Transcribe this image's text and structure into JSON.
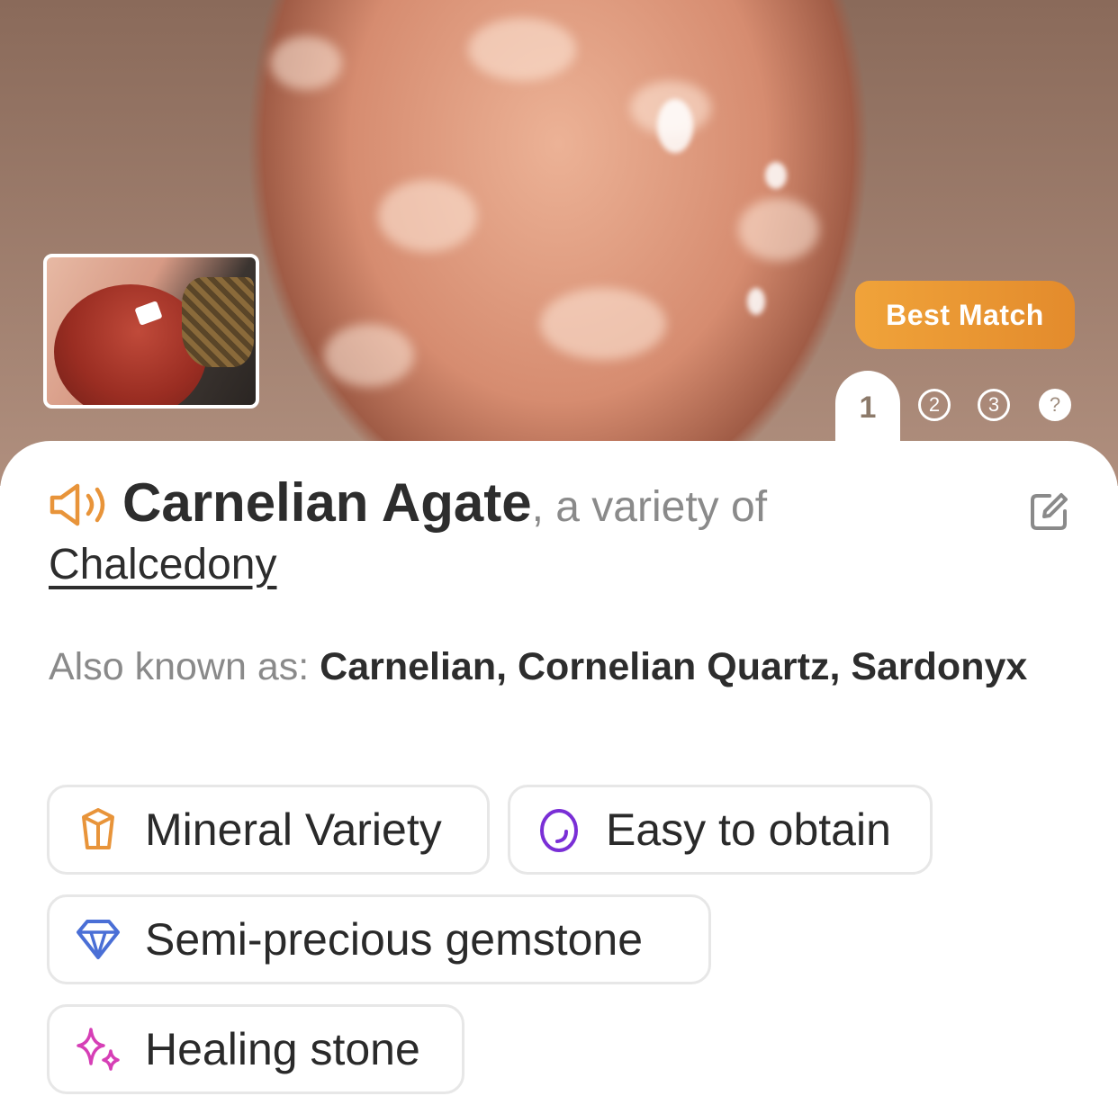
{
  "hero": {
    "badge": "Best Match",
    "pager": [
      "1",
      "2",
      "3",
      "?"
    ],
    "active_page": "1"
  },
  "title": {
    "name": "Carnelian Agate",
    "variety_prefix": ", a variety of",
    "parent": "Chalcedony"
  },
  "aka": {
    "label": "Also known as: ",
    "values": "Carnelian, Cornelian Quartz, Sardonyx"
  },
  "chips": [
    {
      "label": "Mineral Variety",
      "icon": "crystal-icon",
      "color": "#e8943a"
    },
    {
      "label": "Easy to obtain",
      "icon": "egg-icon",
      "color": "#7a2fd6"
    },
    {
      "label": "Semi-precious gemstone",
      "icon": "diamond-icon",
      "color": "#4a6fd6"
    },
    {
      "label": "Healing stone",
      "icon": "sparkles-icon",
      "color": "#d63fb6"
    }
  ],
  "colors": {
    "accent": "#e8943a",
    "badge_gradient_start": "#f0a33a",
    "badge_gradient_end": "#e38b2c"
  }
}
